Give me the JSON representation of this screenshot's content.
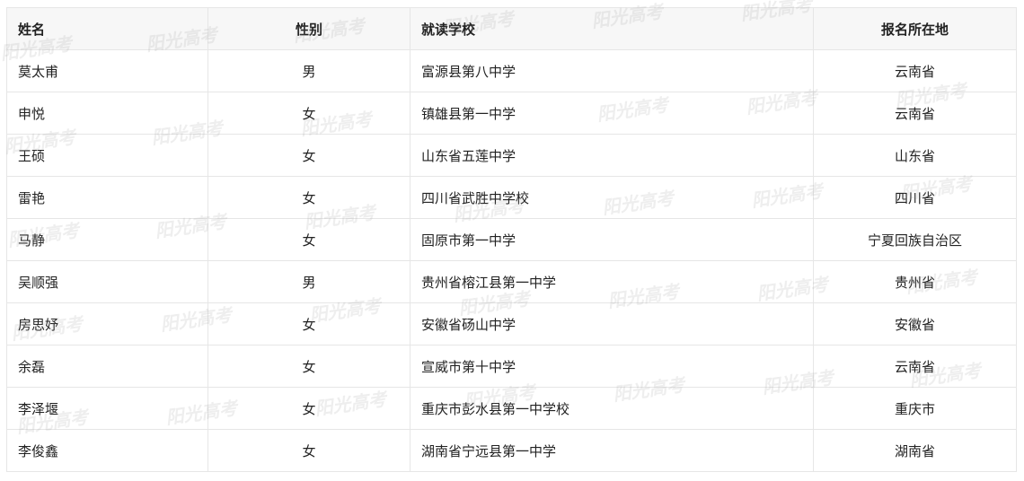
{
  "table": {
    "headers": [
      "姓名",
      "性别",
      "就读学校",
      "报名所在地"
    ],
    "rows": [
      [
        "莫太甫",
        "男",
        "富源县第八中学",
        "云南省"
      ],
      [
        "申悦",
        "女",
        "镇雄县第一中学",
        "云南省"
      ],
      [
        "王硕",
        "女",
        "山东省五莲中学",
        "山东省"
      ],
      [
        "雷艳",
        "女",
        "四川省武胜中学校",
        "四川省"
      ],
      [
        "马静",
        "女",
        "固原市第一中学",
        "宁夏回族自治区"
      ],
      [
        "吴顺强",
        "男",
        "贵州省榕江县第一中学",
        "贵州省"
      ],
      [
        "房思妤",
        "女",
        "安徽省砀山中学",
        "安徽省"
      ],
      [
        "余磊",
        "女",
        "宣威市第十中学",
        "云南省"
      ],
      [
        "李泽堰",
        "女",
        "重庆市彭水县第一中学校",
        "重庆市"
      ],
      [
        "李俊鑫",
        "女",
        "湖南省宁远县第一中学",
        "湖南省"
      ]
    ]
  },
  "watermark": {
    "text": "阳光高考"
  },
  "colors": {
    "header_bg": "#f7f7f7",
    "border": "#e6e6e6",
    "text": "#222222"
  }
}
